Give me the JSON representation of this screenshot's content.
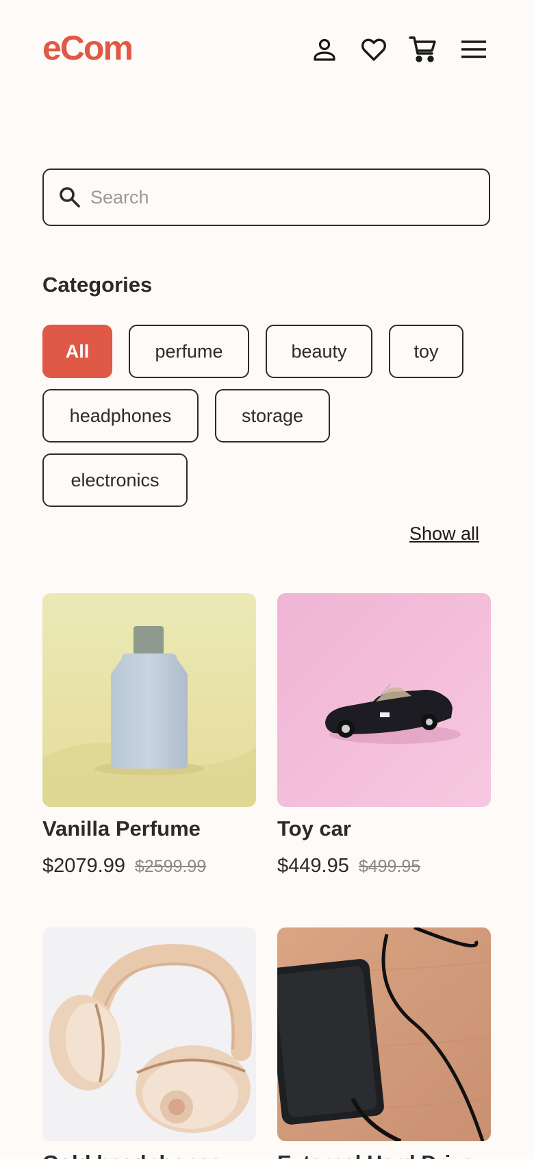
{
  "header": {
    "logo": "eCom",
    "icons": [
      "user-icon",
      "heart-icon",
      "cart-icon",
      "menu-icon"
    ]
  },
  "search": {
    "placeholder": "Search",
    "value": ""
  },
  "categories": {
    "title": "Categories",
    "items": [
      "All",
      "perfume",
      "beauty",
      "toy",
      "headphones",
      "storage",
      "electronics"
    ],
    "selected": "All",
    "show_all": "Show all"
  },
  "products": [
    {
      "name": "Vanilla Perfume",
      "price": "$2079.99",
      "old_price": "$2599.99"
    },
    {
      "name": "Toy car",
      "price": "$449.95",
      "old_price": "$499.95"
    },
    {
      "name": "Gold headphones",
      "price": "",
      "old_price": ""
    },
    {
      "name": "External Hard Drive",
      "price": "",
      "old_price": ""
    }
  ],
  "colors": {
    "accent": "#e05846",
    "background": "#fdfaf7",
    "text": "#2b2b2b"
  }
}
